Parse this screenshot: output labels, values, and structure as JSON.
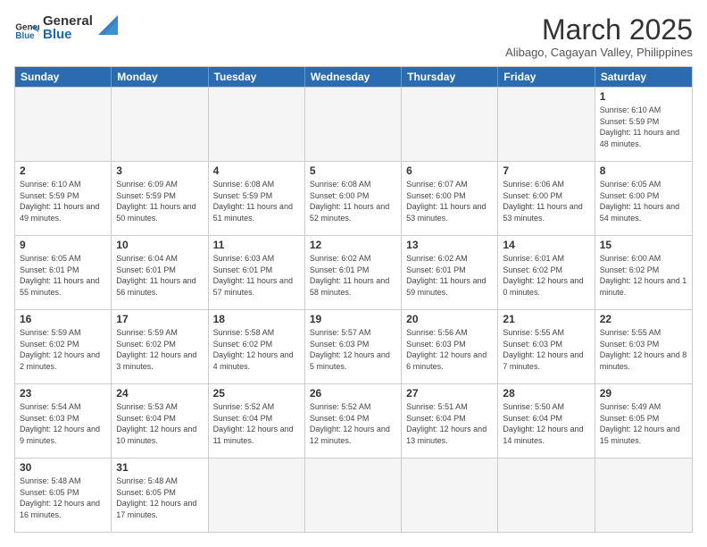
{
  "logo": {
    "general": "General",
    "blue": "Blue"
  },
  "title": "March 2025",
  "subtitle": "Alibago, Cagayan Valley, Philippines",
  "days": [
    "Sunday",
    "Monday",
    "Tuesday",
    "Wednesday",
    "Thursday",
    "Friday",
    "Saturday"
  ],
  "rows": [
    [
      {
        "day": "",
        "info": "",
        "empty": true
      },
      {
        "day": "",
        "info": "",
        "empty": true
      },
      {
        "day": "",
        "info": "",
        "empty": true
      },
      {
        "day": "",
        "info": "",
        "empty": true
      },
      {
        "day": "",
        "info": "",
        "empty": true
      },
      {
        "day": "",
        "info": "",
        "empty": true
      },
      {
        "day": "1",
        "info": "Sunrise: 6:10 AM\nSunset: 5:59 PM\nDaylight: 11 hours and 48 minutes."
      }
    ],
    [
      {
        "day": "2",
        "info": "Sunrise: 6:10 AM\nSunset: 5:59 PM\nDaylight: 11 hours and 49 minutes."
      },
      {
        "day": "3",
        "info": "Sunrise: 6:09 AM\nSunset: 5:59 PM\nDaylight: 11 hours and 50 minutes."
      },
      {
        "day": "4",
        "info": "Sunrise: 6:08 AM\nSunset: 5:59 PM\nDaylight: 11 hours and 51 minutes."
      },
      {
        "day": "5",
        "info": "Sunrise: 6:08 AM\nSunset: 6:00 PM\nDaylight: 11 hours and 52 minutes."
      },
      {
        "day": "6",
        "info": "Sunrise: 6:07 AM\nSunset: 6:00 PM\nDaylight: 11 hours and 53 minutes."
      },
      {
        "day": "7",
        "info": "Sunrise: 6:06 AM\nSunset: 6:00 PM\nDaylight: 11 hours and 53 minutes."
      },
      {
        "day": "8",
        "info": "Sunrise: 6:05 AM\nSunset: 6:00 PM\nDaylight: 11 hours and 54 minutes."
      }
    ],
    [
      {
        "day": "9",
        "info": "Sunrise: 6:05 AM\nSunset: 6:01 PM\nDaylight: 11 hours and 55 minutes."
      },
      {
        "day": "10",
        "info": "Sunrise: 6:04 AM\nSunset: 6:01 PM\nDaylight: 11 hours and 56 minutes."
      },
      {
        "day": "11",
        "info": "Sunrise: 6:03 AM\nSunset: 6:01 PM\nDaylight: 11 hours and 57 minutes."
      },
      {
        "day": "12",
        "info": "Sunrise: 6:02 AM\nSunset: 6:01 PM\nDaylight: 11 hours and 58 minutes."
      },
      {
        "day": "13",
        "info": "Sunrise: 6:02 AM\nSunset: 6:01 PM\nDaylight: 11 hours and 59 minutes."
      },
      {
        "day": "14",
        "info": "Sunrise: 6:01 AM\nSunset: 6:02 PM\nDaylight: 12 hours and 0 minutes."
      },
      {
        "day": "15",
        "info": "Sunrise: 6:00 AM\nSunset: 6:02 PM\nDaylight: 12 hours and 1 minute."
      }
    ],
    [
      {
        "day": "16",
        "info": "Sunrise: 5:59 AM\nSunset: 6:02 PM\nDaylight: 12 hours and 2 minutes."
      },
      {
        "day": "17",
        "info": "Sunrise: 5:59 AM\nSunset: 6:02 PM\nDaylight: 12 hours and 3 minutes."
      },
      {
        "day": "18",
        "info": "Sunrise: 5:58 AM\nSunset: 6:02 PM\nDaylight: 12 hours and 4 minutes."
      },
      {
        "day": "19",
        "info": "Sunrise: 5:57 AM\nSunset: 6:03 PM\nDaylight: 12 hours and 5 minutes."
      },
      {
        "day": "20",
        "info": "Sunrise: 5:56 AM\nSunset: 6:03 PM\nDaylight: 12 hours and 6 minutes."
      },
      {
        "day": "21",
        "info": "Sunrise: 5:55 AM\nSunset: 6:03 PM\nDaylight: 12 hours and 7 minutes."
      },
      {
        "day": "22",
        "info": "Sunrise: 5:55 AM\nSunset: 6:03 PM\nDaylight: 12 hours and 8 minutes."
      }
    ],
    [
      {
        "day": "23",
        "info": "Sunrise: 5:54 AM\nSunset: 6:03 PM\nDaylight: 12 hours and 9 minutes."
      },
      {
        "day": "24",
        "info": "Sunrise: 5:53 AM\nSunset: 6:04 PM\nDaylight: 12 hours and 10 minutes."
      },
      {
        "day": "25",
        "info": "Sunrise: 5:52 AM\nSunset: 6:04 PM\nDaylight: 12 hours and 11 minutes."
      },
      {
        "day": "26",
        "info": "Sunrise: 5:52 AM\nSunset: 6:04 PM\nDaylight: 12 hours and 12 minutes."
      },
      {
        "day": "27",
        "info": "Sunrise: 5:51 AM\nSunset: 6:04 PM\nDaylight: 12 hours and 13 minutes."
      },
      {
        "day": "28",
        "info": "Sunrise: 5:50 AM\nSunset: 6:04 PM\nDaylight: 12 hours and 14 minutes."
      },
      {
        "day": "29",
        "info": "Sunrise: 5:49 AM\nSunset: 6:05 PM\nDaylight: 12 hours and 15 minutes."
      }
    ],
    [
      {
        "day": "30",
        "info": "Sunrise: 5:48 AM\nSunset: 6:05 PM\nDaylight: 12 hours and 16 minutes."
      },
      {
        "day": "31",
        "info": "Sunrise: 5:48 AM\nSunset: 6:05 PM\nDaylight: 12 hours and 17 minutes."
      },
      {
        "day": "",
        "info": "",
        "empty": true
      },
      {
        "day": "",
        "info": "",
        "empty": true
      },
      {
        "day": "",
        "info": "",
        "empty": true
      },
      {
        "day": "",
        "info": "",
        "empty": true
      },
      {
        "day": "",
        "info": "",
        "empty": true
      }
    ]
  ]
}
